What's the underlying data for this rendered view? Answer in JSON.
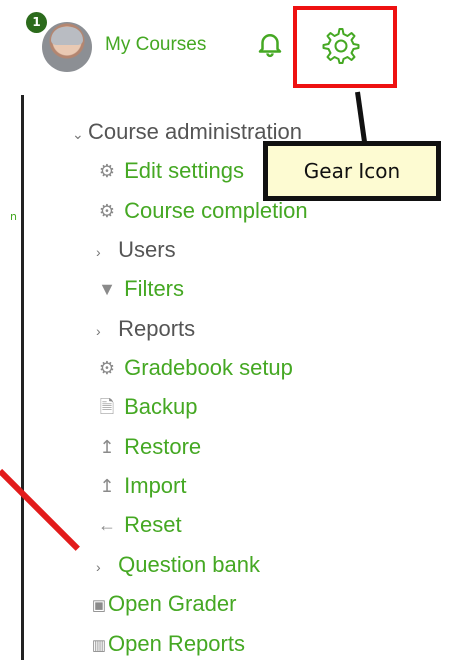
{
  "header": {
    "notification_count": "1",
    "my_courses_label": "My Courses"
  },
  "callout": {
    "label": "Gear Icon"
  },
  "left_stub": "n",
  "menu": {
    "course_admin": "Course administration",
    "items": [
      {
        "label": "Edit settings",
        "icon": "gear-icon"
      },
      {
        "label": "Course completion",
        "icon": "gear-icon"
      },
      {
        "label": "Users",
        "icon": "chevron-right-icon"
      },
      {
        "label": "Filters",
        "icon": "filter-icon"
      },
      {
        "label": "Reports",
        "icon": "chevron-right-icon"
      },
      {
        "label": "Gradebook setup",
        "icon": "gear-icon"
      },
      {
        "label": "Backup",
        "icon": "file-icon"
      },
      {
        "label": "Restore",
        "icon": "upload-icon"
      },
      {
        "label": "Import",
        "icon": "upload-icon"
      },
      {
        "label": "Reset",
        "icon": "arrow-left-icon"
      },
      {
        "label": "Question bank",
        "icon": "chevron-right-icon"
      },
      {
        "label": "Open Grader",
        "icon": "grader-icon"
      },
      {
        "label": "Open Reports",
        "icon": "chart-icon"
      }
    ]
  },
  "colors": {
    "link_green": "#45a823",
    "annotation_red": "#ee1111",
    "callout_bg": "#fdfbd2"
  }
}
